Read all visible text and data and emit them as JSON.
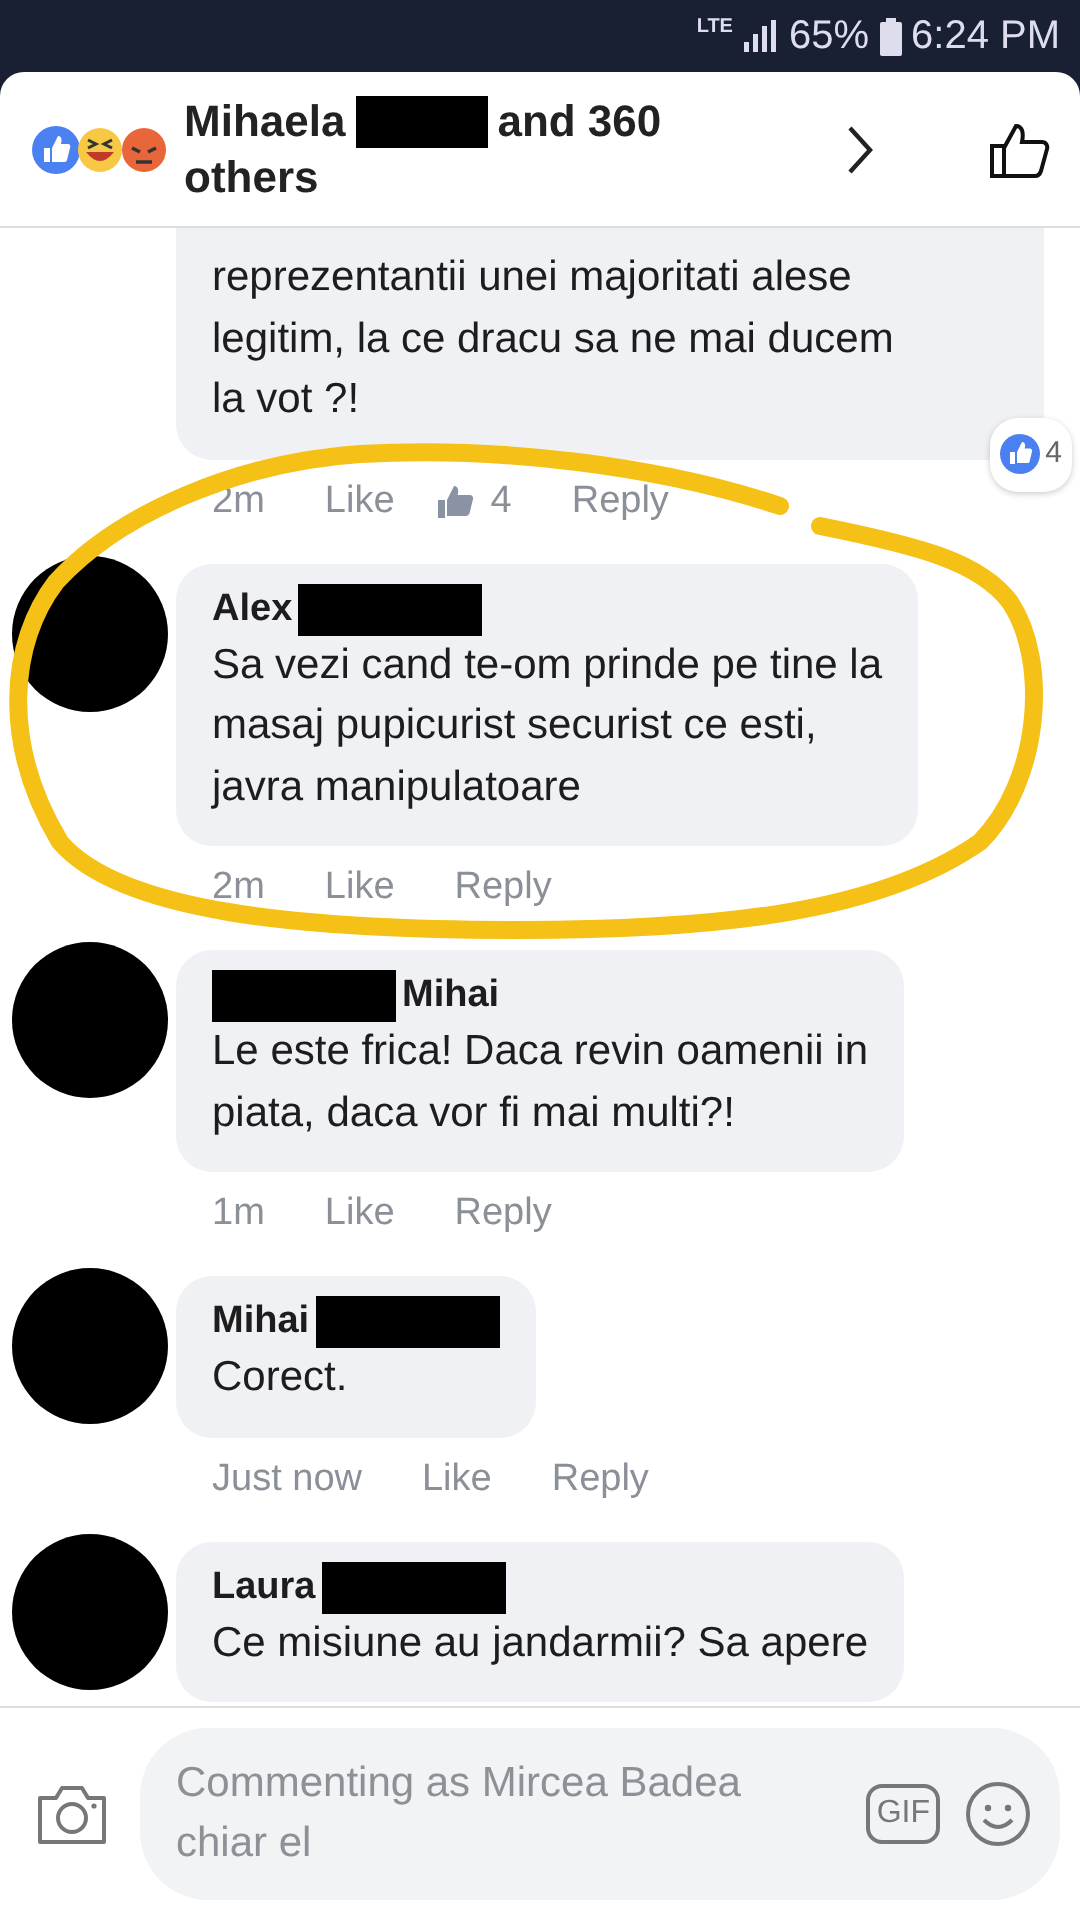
{
  "status_bar": {
    "network": "LTE",
    "battery": "65%",
    "time": "6:24 PM"
  },
  "header": {
    "name_before": "Mihaela",
    "name_after": "and 360",
    "line2": "others"
  },
  "comments": [
    {
      "lines": [
        "reprezentantii unei majoritati alese",
        "legitim, la ce dracu sa ne mai ducem",
        "la vot ?!"
      ],
      "time": "2m",
      "like": "Like",
      "like_count": "4",
      "reply": "Reply",
      "reaction_count": "4"
    },
    {
      "author": "Alex",
      "redaction_first": false,
      "lines": [
        "Sa vezi cand te-om prinde pe tine la",
        "masaj pupicurist securist ce esti,",
        "javra manipulatoare"
      ],
      "time": "2m",
      "like": "Like",
      "reply": "Reply"
    },
    {
      "author": "Mihai",
      "redaction_first": true,
      "lines": [
        "Le este frica! Daca revin oamenii in",
        "piata, daca vor fi mai multi?!"
      ],
      "time": "1m",
      "like": "Like",
      "reply": "Reply"
    },
    {
      "author": "Mihai",
      "redaction_first": false,
      "lines": [
        "Corect."
      ],
      "time": "Just now",
      "like": "Like",
      "reply": "Reply"
    },
    {
      "author": "Laura",
      "redaction_first": false,
      "lines": [
        "Ce misiune au jandarmii? Sa apere"
      ]
    }
  ],
  "composer": {
    "placeholder": "Commenting as Mircea Badea chiar el",
    "gif": "GIF"
  }
}
